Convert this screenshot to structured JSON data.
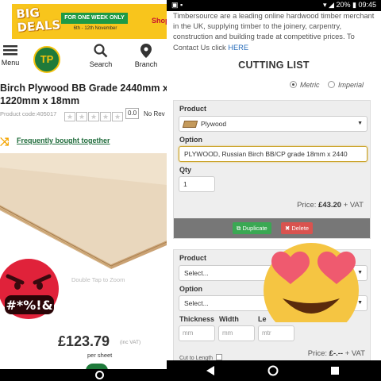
{
  "left": {
    "banner": {
      "big_line1": "BIG",
      "big_line2": "DEALS",
      "pill": "FOR ONE WEEK ONLY",
      "dates": "6th - 12th November",
      "shop": "Shop n"
    },
    "nav": {
      "menu": "Menu",
      "logo_text": "TP",
      "search": "Search",
      "branch": "Branch"
    },
    "product": {
      "title_line1": "Birch Plywood BB Grade 2440mm x",
      "title_line2": "1220mm x 18mm",
      "code": "Product code:405017",
      "rating": "0.0",
      "reviews": "No Rev",
      "frequently_bought": "Frequently bought together",
      "zoom_hint": "Double Tap to Zoom",
      "price": "£123.79",
      "inc_vat": "(inc VAT)",
      "per_sheet": "per sheet"
    },
    "sticker_text": "#*%!&"
  },
  "right": {
    "status": {
      "time": "09:45",
      "battery": "20%"
    },
    "intro_text": "Timbersource are a leading online hardwood timber merchant in the UK, supplying timber to the joinery, carpentry, construction and building trade at competitive prices. To Contact Us click ",
    "intro_link": "HERE",
    "title": "CUTTING LIST",
    "units": {
      "metric": "Metric",
      "imperial": "Imperial",
      "selected": "Metric"
    },
    "item1": {
      "product_label": "Product",
      "product_value": "Plywood",
      "option_label": "Option",
      "option_value": "PLYWOOD, Russian Birch BB/CP grade 18mm x 2440",
      "qty_label": "Qty",
      "qty_value": "1",
      "price_label": "Price:",
      "price_value": "£43.20",
      "price_suffix": "+ VAT",
      "duplicate": "Duplicate",
      "delete": "Delete"
    },
    "item2": {
      "product_label": "Product",
      "product_value": "Select...",
      "option_label": "Option",
      "option_value": "Select...",
      "thickness_label": "Thickness",
      "width_label": "Width",
      "length_label": "Le",
      "mm": "mm",
      "mtr": "mtr",
      "cut_label": "Cut to Length",
      "price_label": "Price:",
      "price_value": "£-.--",
      "price_suffix": "+ VAT"
    }
  },
  "colors": {
    "banner_yellow": "#f8c51c",
    "tp_green": "#1f7a3a",
    "link_green": "#1e6b3a",
    "duplicate_green": "#3aa853",
    "delete_red": "#d9534f",
    "angry_red": "#e0223a",
    "emoji_yellow": "#f5c542"
  }
}
